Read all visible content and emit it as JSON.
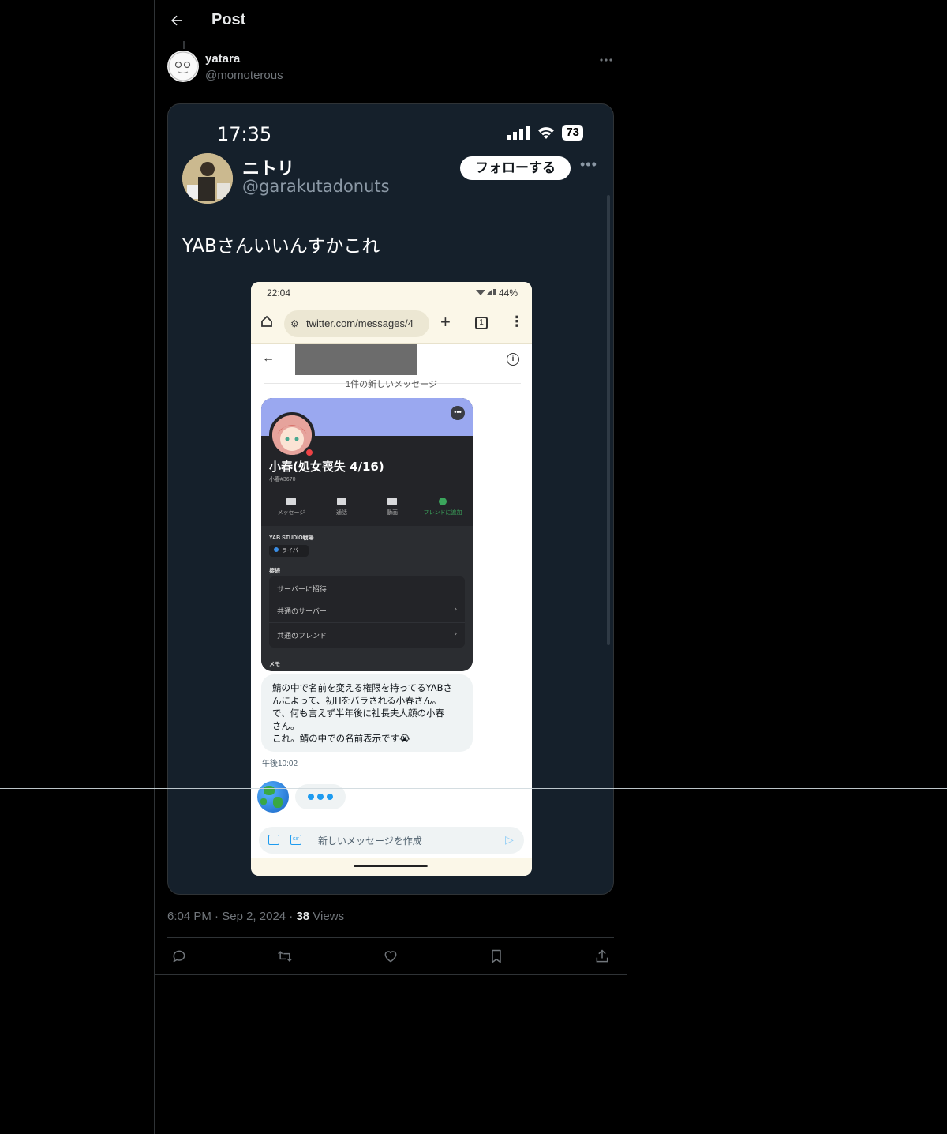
{
  "header": {
    "title": "Post"
  },
  "author": {
    "name": "yatara",
    "handle": "@momoterous"
  },
  "screenshot": {
    "time": "17:35",
    "battery": "73",
    "user_name": "ニトリ",
    "user_handle": "@garakutadonuts",
    "follow_label": "フォローする",
    "tweet_text": "YABさんいいんすかこれ",
    "phone": {
      "time": "22:04",
      "status_right": "44%",
      "url": "twitter.com/messages/4",
      "tabs_count": "1",
      "new_message_divider": "1件の新しいメッセージ",
      "discord": {
        "display_name": "小春(処女喪失 4/16)",
        "username": "小春#3670",
        "actions": [
          {
            "label": "メッセージ"
          },
          {
            "label": "通話"
          },
          {
            "label": "動画"
          },
          {
            "label": "フレンドに追加"
          }
        ],
        "server_section": "YAB STUDIO戦場",
        "role": "ライバー",
        "connections_section": "接続",
        "rows": [
          "サーバーに招待",
          "共通のサーバー",
          "共通のフレンド"
        ],
        "memo_section": "メモ"
      },
      "message": {
        "line1": "鯖の中で名前を変える権限を持ってるYABさ",
        "line2": "んによって、初Hをバラされる小春さん。",
        "line3": "で、何も言えず半年後に社長夫人顔の小春",
        "line4": "さん。",
        "line5": "これ。鯖の中での名前表示です😭"
      },
      "message_time": "午後10:02",
      "composer_placeholder": "新しいメッセージを作成"
    }
  },
  "meta": {
    "time": "6:04 PM",
    "date": "Sep 2, 2024",
    "views_count": "38",
    "views_label": "Views"
  },
  "icons": {
    "back": "arrow-left-icon",
    "more": "more-horizontal-icon",
    "reply": "reply-icon",
    "repost": "repost-icon",
    "like": "heart-icon",
    "bookmark": "bookmark-icon",
    "share": "share-icon"
  }
}
